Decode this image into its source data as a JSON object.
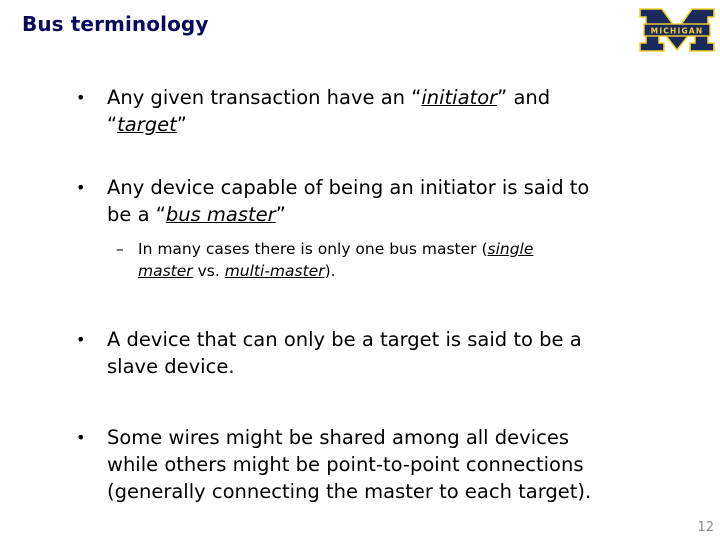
{
  "slide": {
    "title": "Bus terminology",
    "logo": {
      "icon": "michigan-block-m-logo",
      "text": "MICHIGAN",
      "colors": {
        "navy": "#1b2a5c",
        "maize": "#f2d22e"
      }
    },
    "page_number": "12"
  },
  "bullets": [
    {
      "marker": "•",
      "parts": {
        "a": "Any given transaction have an “",
        "b": "initiator",
        "c": "” and",
        "d": "“",
        "e": "target",
        "f": "”"
      }
    },
    {
      "marker": "•",
      "parts": {
        "a": "Any device capable of being an initiator is said to",
        "b": "be a “",
        "c": "bus master",
        "d": "”"
      },
      "sub": {
        "marker": "–",
        "parts": {
          "a": "In many cases there is only one bus master (",
          "b": "single",
          "c": "master",
          "d": " vs. ",
          "e": "multi-master",
          "f": ")."
        }
      }
    },
    {
      "marker": "•",
      "lines": [
        "A device that can only be a target is said to be a",
        "slave device."
      ]
    },
    {
      "marker": "•",
      "lines": [
        "Some wires might be shared among all devices",
        "while others might be point-to-point connections",
        "(generally connecting the master to each target)."
      ]
    }
  ]
}
